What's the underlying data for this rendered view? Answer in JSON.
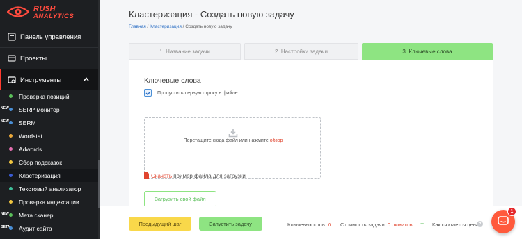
{
  "brand": {
    "line1": "RU$H",
    "line2": "ANALYTICS",
    "accent": "#ff4b3e"
  },
  "sidebar": {
    "main": [
      {
        "label": "Панель управления",
        "icon": "speedometer-icon"
      },
      {
        "label": "Проекты",
        "icon": "folder-icon"
      },
      {
        "label": "Инструменты",
        "icon": "tools-icon",
        "expanded": true
      }
    ],
    "items": [
      {
        "label": "Проверка позиций",
        "dot": "#5bbf5a",
        "badge": ""
      },
      {
        "label": "SERP монитор",
        "dot": "#4a8fd6",
        "badge": "NEW"
      },
      {
        "label": "SERM",
        "dot": "#4a8fd6",
        "badge": "NEW"
      },
      {
        "label": "Wordstat",
        "dot": "#e9a83b",
        "badge": ""
      },
      {
        "label": "Adwords",
        "dot": "#e56fb1",
        "badge": ""
      },
      {
        "label": "Сбор подсказок",
        "dot": "#f0c540",
        "badge": ""
      },
      {
        "label": "Кластеризация",
        "dot": "#3a5bd4",
        "badge": "",
        "active": true
      },
      {
        "label": "Текстовый анализатор",
        "dot": "#3fbf9a",
        "badge": ""
      },
      {
        "label": "Проверка индексации",
        "dot": "#f0c540",
        "badge": ""
      },
      {
        "label": "Мета сканер",
        "dot": "#5bbf5a",
        "badge": "NEW"
      },
      {
        "label": "Аудит сайта",
        "dot": "#4a8fd6",
        "badge": "BETA"
      }
    ]
  },
  "page": {
    "title": "Кластеризация - Создать новую задачу",
    "breadcrumb": {
      "home": "Главная",
      "sep": " / ",
      "section": "Кластеризация",
      "current": "Создать новую задачу"
    }
  },
  "tabs": [
    {
      "label": "1. Название задачи",
      "active": false
    },
    {
      "label": "2. Настройки задачи",
      "active": false
    },
    {
      "label": "3. Ключевые слова",
      "active": true
    }
  ],
  "form": {
    "section_title": "Ключевые слова",
    "skip_first_row_label": "Пропустить первую строку в файле",
    "skip_first_row_checked": true,
    "dropzone_text": "Перетащите сюда файл или нажмите ",
    "dropzone_browse": "обзор",
    "download_link": "Скачать",
    "download_rest": " пример файла для загрузки",
    "upload_button": "Загрузить свой файл"
  },
  "footer": {
    "prev_button": "Предыдущий шаг",
    "run_button": "Запустить задачу",
    "keywords_label": "Ключевых слов: ",
    "keywords_value": "0",
    "cost_label": "Стоимость задачи: ",
    "cost_value": "0 лимитов",
    "how_label": "Как считается цена",
    "help": "?"
  },
  "chat": {
    "unread": "1"
  },
  "colors": {
    "accent_green": "#8ee482",
    "accent_red": "#e0452f",
    "sidebar_bg": "#1d1f22"
  }
}
